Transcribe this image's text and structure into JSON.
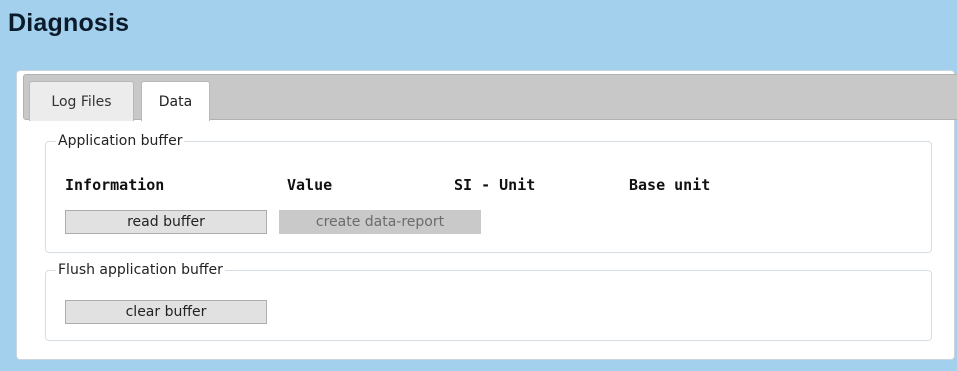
{
  "page": {
    "title": "Diagnosis"
  },
  "tabs": [
    {
      "label": "Log Files",
      "active": false
    },
    {
      "label": "Data",
      "active": true
    }
  ],
  "application_buffer": {
    "legend": "Application buffer",
    "columns": [
      "Information",
      "Value",
      "SI - Unit",
      "Base unit"
    ],
    "read_button": "read buffer",
    "report_button": "create data-report",
    "report_button_disabled": true
  },
  "flush_buffer": {
    "legend": "Flush application buffer",
    "clear_button": "clear buffer"
  },
  "colors": {
    "header_background": "#a3d0ec",
    "tab_strip": "#c8c8c8",
    "button_background": "#e1e1e1",
    "disabled_button_background": "#c9c9c9"
  }
}
